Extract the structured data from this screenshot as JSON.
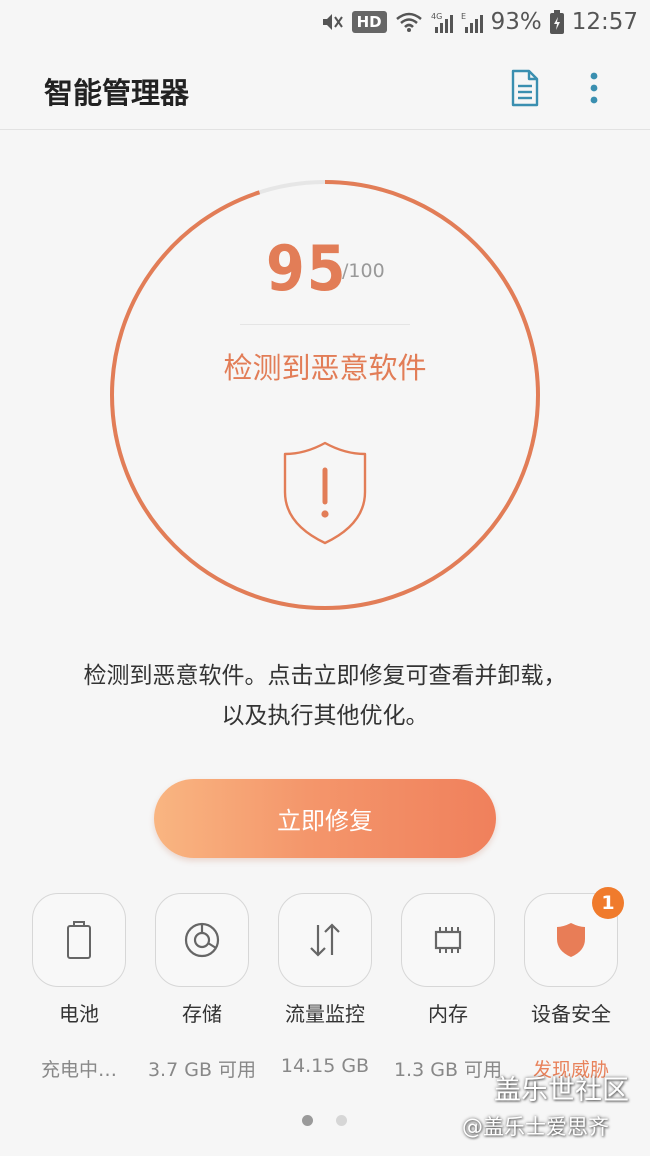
{
  "status_bar": {
    "network_badge": "HD",
    "signal_4g": "4G",
    "signal_e": "E",
    "battery_text": "93%",
    "time": "12:57"
  },
  "app_bar": {
    "title": "智能管理器",
    "report_icon": "document-icon",
    "more_icon": "more-vert-icon"
  },
  "score": {
    "value": "95",
    "max": "/100",
    "fraction": 0.95,
    "status": "检测到恶意软件"
  },
  "description": {
    "line1": "检测到恶意软件。点击立即修复可查看并卸载，",
    "line2": "以及执行其他优化。"
  },
  "fix_button": {
    "label": "立即修复"
  },
  "tiles": [
    {
      "label": "电池",
      "value": "充电中…",
      "icon": "battery-icon"
    },
    {
      "label": "存储",
      "value": "3.7 GB 可用",
      "icon": "storage-icon"
    },
    {
      "label": "流量监控",
      "value": "14.15 GB",
      "icon": "data-transfer-icon"
    },
    {
      "label": "内存",
      "value": "1.3 GB 可用",
      "icon": "memory-chip-icon"
    },
    {
      "label": "设备安全",
      "value": "发现威胁",
      "icon": "shield-icon",
      "badge": "1"
    }
  ],
  "pager": {
    "current": 1,
    "total": 2
  },
  "watermark": {
    "main": "盖乐世社区",
    "sub": "@盖乐士爱思齐"
  },
  "colors": {
    "accent": "#e27d57",
    "badge": "#f07b2c",
    "ring_track": "#e6e6e6"
  }
}
